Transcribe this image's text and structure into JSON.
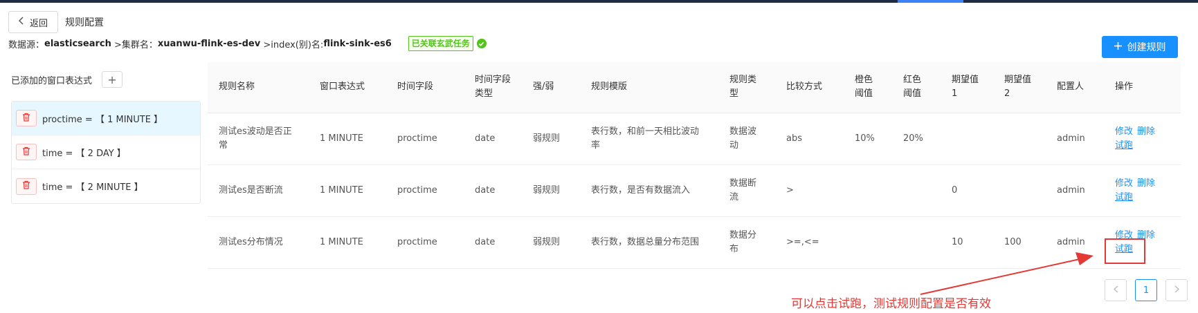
{
  "header": {
    "back_label": "返回",
    "title": "规则配置"
  },
  "info": {
    "datasource_label": "数据源：",
    "datasource_value": "elasticsearch",
    "cluster_label": ">集群名：",
    "cluster_value": "xuanwu-flink-es-dev",
    "index_label": ">index(别)名: ",
    "index_value": "flink-sink-es6",
    "linked_badge": "已关联玄武任务"
  },
  "create_button": "创建规则",
  "window_exprs": {
    "heading": "已添加的窗口表达式",
    "items": [
      "proctime = 【 1 MINUTE 】",
      "time = 【 2 DAY 】",
      "time = 【 2 MINUTE 】"
    ]
  },
  "table": {
    "headers": [
      "规则名称",
      "窗口表达式",
      "时间字段",
      "时间字段类型",
      "强/弱",
      "规则模版",
      "规则类型",
      "比较方式",
      "橙色阈值",
      "红色阈值",
      "期望值1",
      "期望值2",
      "配置人",
      "操作"
    ],
    "rows": [
      [
        "测试es波动是否正常",
        "1 MINUTE",
        "proctime",
        "date",
        "弱规则",
        "表行数，和前一天相比波动率",
        "数据波动",
        "abs",
        "10%",
        "20%",
        "",
        "",
        "admin"
      ],
      [
        "测试es是否断流",
        "1 MINUTE",
        "proctime",
        "date",
        "弱规则",
        "表行数，是否有数据流入",
        "数据断流",
        ">",
        "",
        "",
        "0",
        "",
        "admin"
      ],
      [
        "测试es分布情况",
        "1 MINUTE",
        "proctime",
        "date",
        "弱规则",
        "表行数，数据总量分布范围",
        "数据分布",
        ">=,<=",
        "",
        "",
        "10",
        "100",
        "admin"
      ]
    ],
    "ops": {
      "edit": "修改",
      "delete": "删除",
      "run": "试跑"
    }
  },
  "annotation": "可以点击试跑，测试规则配置是否有效",
  "pagination": {
    "current_page": "1"
  },
  "colors": {
    "primary": "#1890ff",
    "success": "#52c41a",
    "danger": "#e53935"
  }
}
